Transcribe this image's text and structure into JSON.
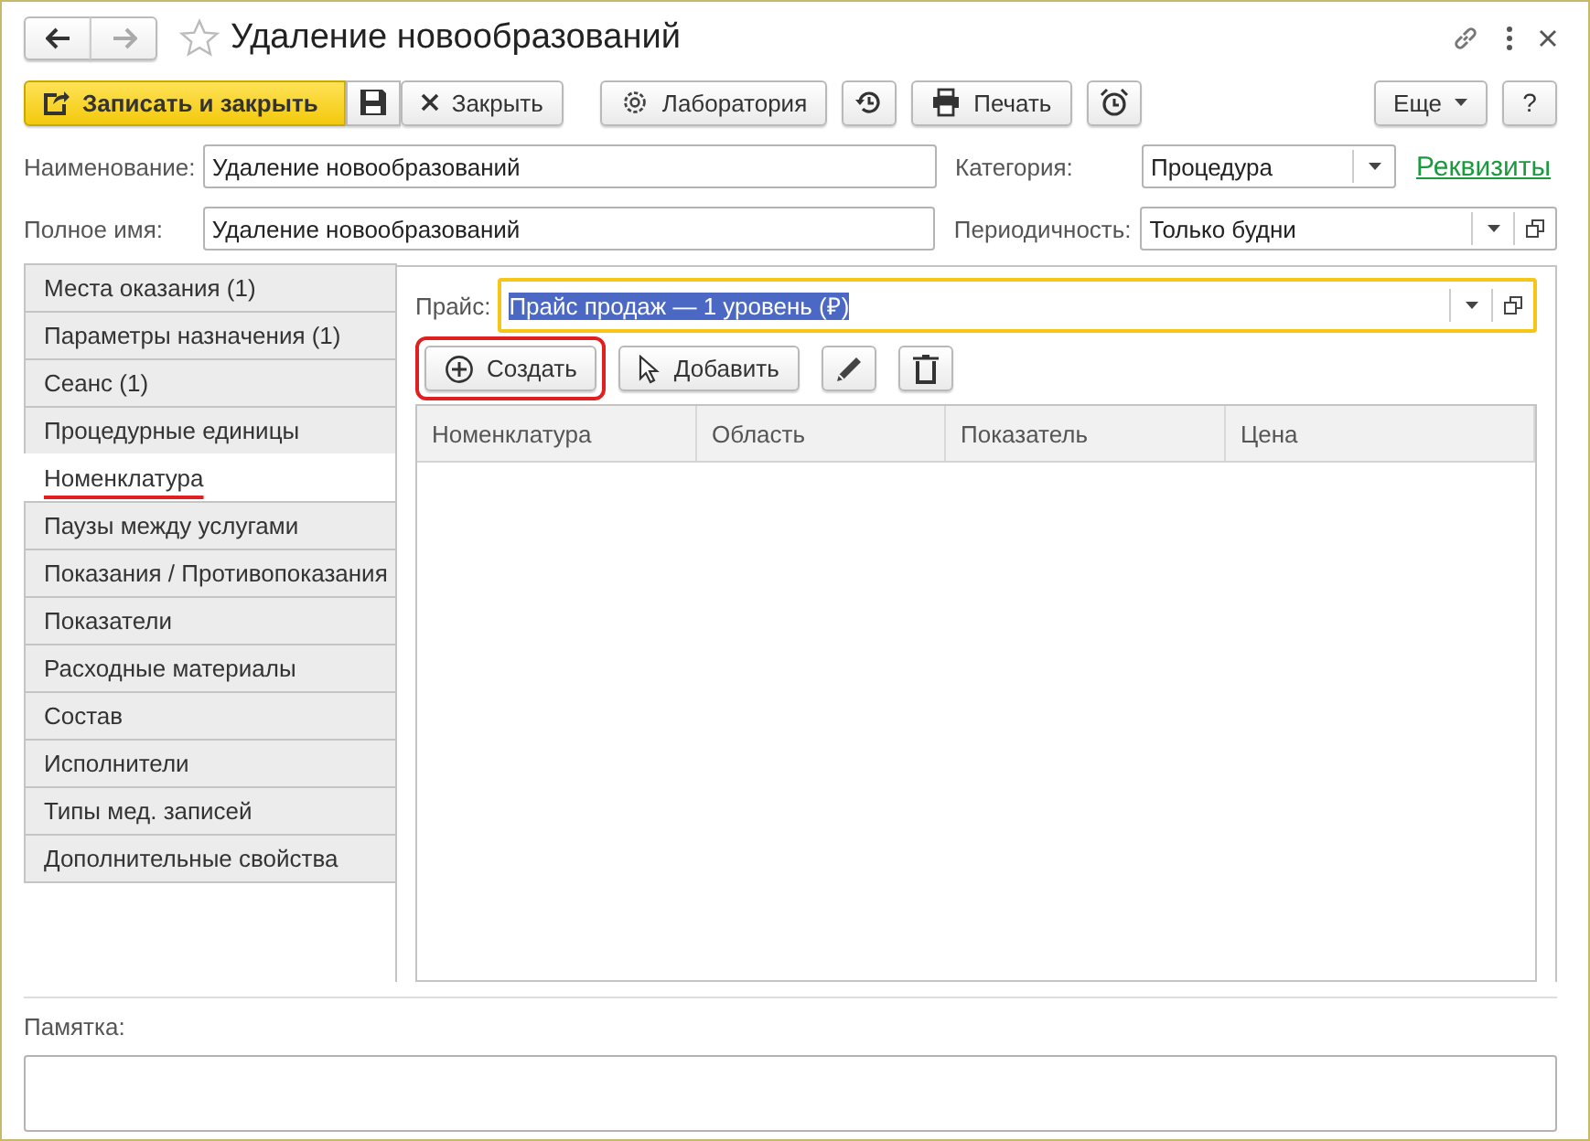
{
  "window": {
    "title": "Удаление новообразований"
  },
  "toolbar": {
    "buttons": [
      {
        "kind": "save-close",
        "label": "Записать и закрыть"
      },
      {
        "kind": "save"
      },
      {
        "kind": "close",
        "label": "Закрыть"
      },
      {
        "kind": "lab",
        "label": "Лаборатория"
      },
      {
        "kind": "history"
      },
      {
        "kind": "print",
        "label": "Печать"
      },
      {
        "kind": "reminder"
      },
      {
        "kind": "more",
        "label": "Еще"
      },
      {
        "kind": "help",
        "label": "?"
      }
    ]
  },
  "fields": {
    "name": {
      "label": "Наименование:",
      "value": "Удаление новообразований"
    },
    "full_name": {
      "label": "Полное имя:",
      "value": "Удаление новообразований"
    },
    "category": {
      "label": "Категория:",
      "value": "Процедура"
    },
    "periodicity": {
      "label": "Периодичность:",
      "value": "Только будни"
    },
    "details_link": "Реквизиты"
  },
  "tabs": [
    {
      "label": "Места оказания (1)",
      "selected": false
    },
    {
      "label": "Параметры назначения (1)",
      "selected": false
    },
    {
      "label": "Сеанс (1)",
      "selected": false
    },
    {
      "label": "Процедурные единицы",
      "selected": false
    },
    {
      "label": "Номенклатура",
      "selected": true
    },
    {
      "label": "Паузы между услугами",
      "selected": false
    },
    {
      "label": "Показания / Противопоказания",
      "selected": false
    },
    {
      "label": "Показатели",
      "selected": false
    },
    {
      "label": "Расходные материалы",
      "selected": false
    },
    {
      "label": "Состав",
      "selected": false
    },
    {
      "label": "Исполнители",
      "selected": false
    },
    {
      "label": "Типы мед. записей",
      "selected": false
    },
    {
      "label": "Дополнительные свойства",
      "selected": false
    }
  ],
  "price": {
    "label": "Прайс:",
    "value": "Прайс продаж — 1 уровень (₽)",
    "focused": true
  },
  "table_toolbar": [
    {
      "kind": "create",
      "label": "Создать",
      "highlighted": true
    },
    {
      "kind": "add",
      "label": "Добавить",
      "highlighted": false
    },
    {
      "kind": "edit",
      "highlighted": false
    },
    {
      "kind": "delete",
      "highlighted": false
    }
  ],
  "table": {
    "columns": [
      "Номенклатура",
      "Область",
      "Показатель",
      "Цена"
    ]
  },
  "memo": {
    "label": "Памятка:"
  }
}
